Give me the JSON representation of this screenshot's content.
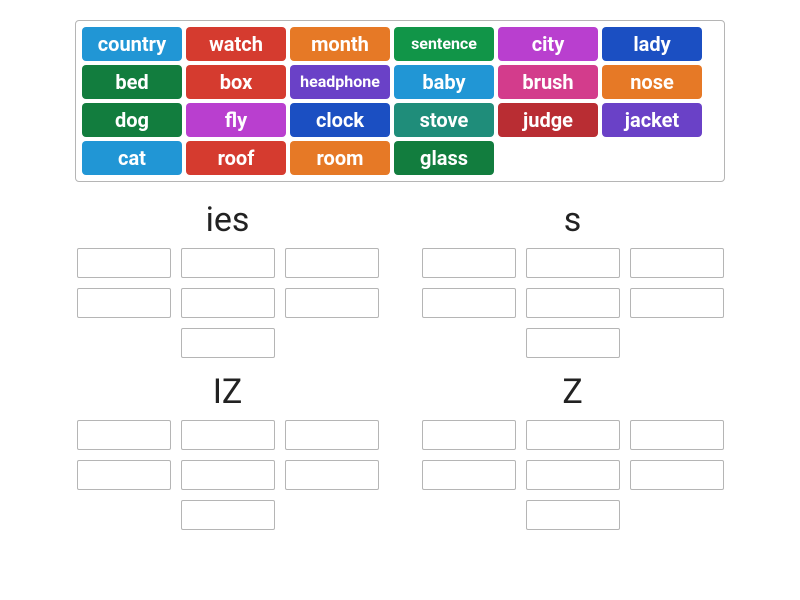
{
  "bank": {
    "cards": [
      {
        "label": "country",
        "color": "c-blue"
      },
      {
        "label": "watch",
        "color": "c-red"
      },
      {
        "label": "month",
        "color": "c-orange"
      },
      {
        "label": "sentence",
        "color": "c-green",
        "small": true
      },
      {
        "label": "city",
        "color": "c-magenta"
      },
      {
        "label": "lady",
        "color": "c-dblue"
      },
      {
        "label": "bed",
        "color": "c-dgreen"
      },
      {
        "label": "box",
        "color": "c-red"
      },
      {
        "label": "headphone",
        "color": "c-purple",
        "small": true
      },
      {
        "label": "baby",
        "color": "c-blue"
      },
      {
        "label": "brush",
        "color": "c-pink"
      },
      {
        "label": "nose",
        "color": "c-orange"
      },
      {
        "label": "dog",
        "color": "c-dgreen"
      },
      {
        "label": "fly",
        "color": "c-magenta"
      },
      {
        "label": "clock",
        "color": "c-dblue"
      },
      {
        "label": "stove",
        "color": "c-teal"
      },
      {
        "label": "judge",
        "color": "c-dred"
      },
      {
        "label": "jacket",
        "color": "c-purple"
      },
      {
        "label": "cat",
        "color": "c-blue"
      },
      {
        "label": "roof",
        "color": "c-red"
      },
      {
        "label": "room",
        "color": "c-orange"
      },
      {
        "label": "glass",
        "color": "c-dgreen"
      }
    ]
  },
  "groups": [
    {
      "title": "ies",
      "slots": 7
    },
    {
      "title": "s",
      "slots": 7
    },
    {
      "title": "IZ",
      "slots": 7
    },
    {
      "title": "Z",
      "slots": 7
    }
  ]
}
